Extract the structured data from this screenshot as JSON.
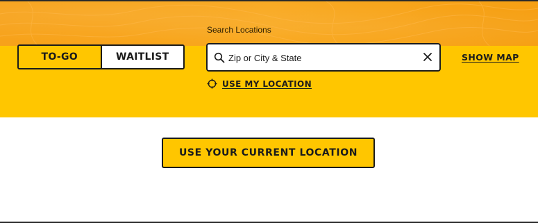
{
  "order_mode": {
    "options": [
      {
        "label": "TO-GO",
        "selected": true
      },
      {
        "label": "WAITLIST",
        "selected": false
      }
    ]
  },
  "search": {
    "label": "Search Locations",
    "placeholder": "Zip or City & State",
    "value": "",
    "search_icon": "search-icon",
    "clear_icon": "close-icon"
  },
  "show_map": {
    "label": "SHOW MAP"
  },
  "use_my_location": {
    "label": "USE MY LOCATION",
    "icon": "crosshair-icon"
  },
  "current_location_button": {
    "label": "USE YOUR CURRENT LOCATION"
  },
  "colors": {
    "header_orange": "#f9a81e",
    "header_yellow": "#ffc600",
    "text_dark": "#1b1b1b",
    "background": "#ffffff"
  }
}
